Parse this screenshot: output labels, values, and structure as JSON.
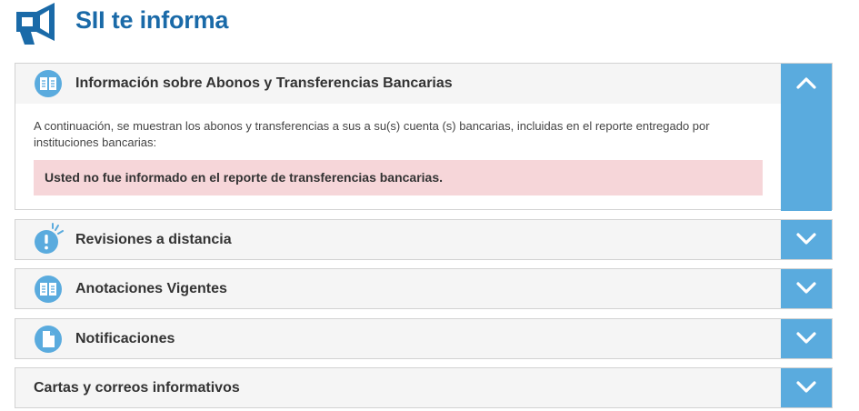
{
  "header": {
    "title": "SII te informa",
    "icon": "megaphone-icon"
  },
  "colors": {
    "brand_blue": "#1a6aa8",
    "toggle_blue": "#5aabde",
    "alert_bg": "#f6d6d9",
    "panel_head_bg": "#f5f5f5"
  },
  "panels": [
    {
      "title": "Información sobre Abonos y Transferencias Bancarias",
      "icon": "book-icon",
      "expanded": true,
      "body_text": "A continuación, se muestran los abonos y transferencias a sus a su(s) cuenta (s) bancarias, incluidas en el reporte entregado por instituciones bancarias:",
      "alert_text": "Usted no fue informado en el reporte de transferencias bancarias."
    },
    {
      "title": "Revisiones a distancia",
      "icon": "exclamation-icon",
      "expanded": false
    },
    {
      "title": "Anotaciones Vigentes",
      "icon": "book-icon",
      "expanded": false
    },
    {
      "title": "Notificaciones",
      "icon": "document-icon",
      "expanded": false
    },
    {
      "title": "Cartas y correos informativos",
      "icon": "",
      "expanded": false
    }
  ]
}
